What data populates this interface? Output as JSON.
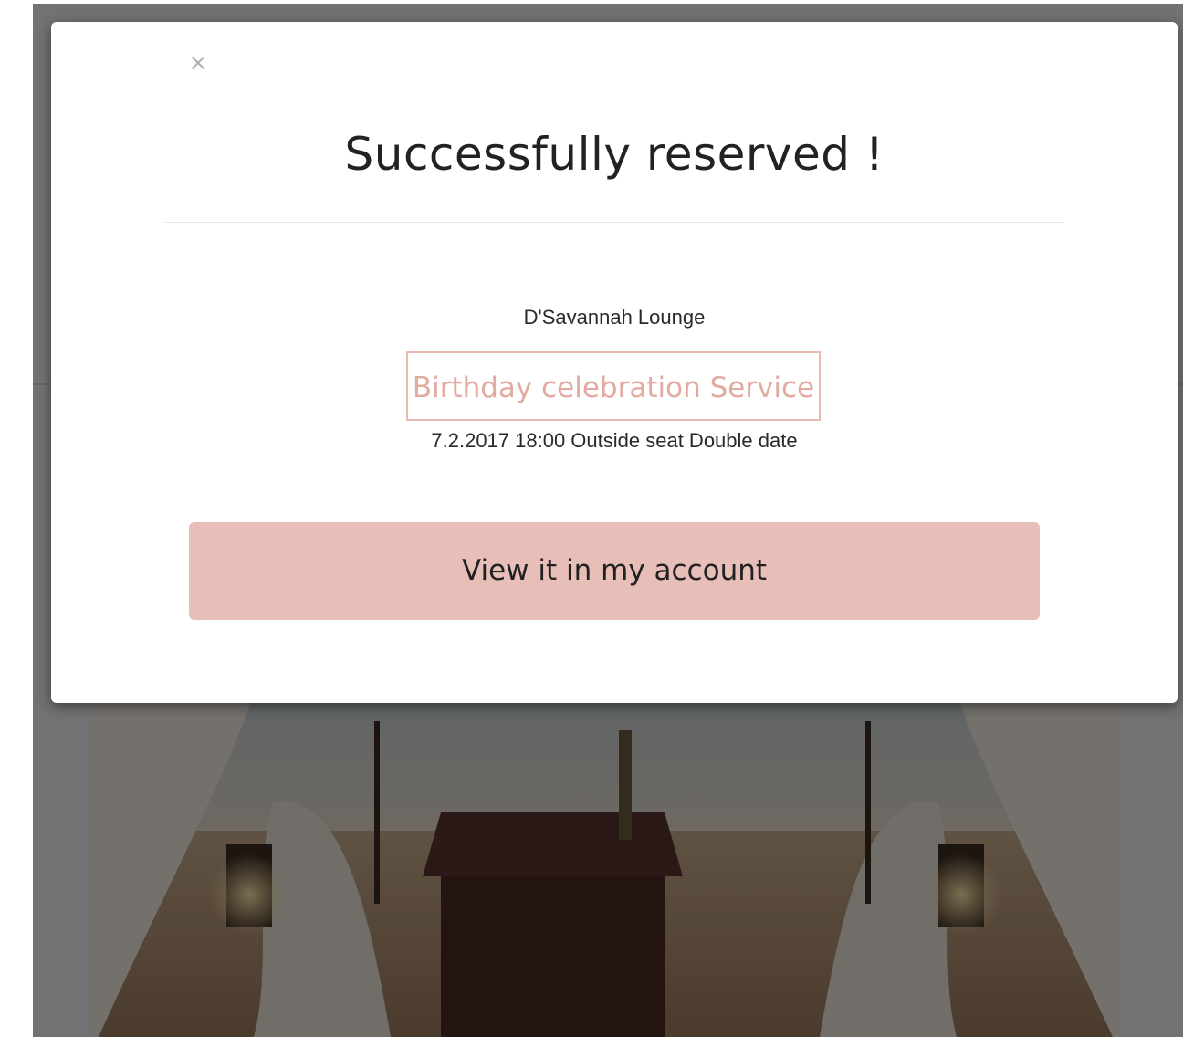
{
  "modal": {
    "close_label": "×",
    "title": "Successfully reserved !",
    "venue_name": "D'Savannah Lounge",
    "service_name": "Birthday celebration Service",
    "reservation_details": "7.2.2017 18:00 Outside seat Double date",
    "view_account_label": "View it in my account"
  },
  "colors": {
    "accent": "#e8beb8",
    "service_text": "#e2aba2",
    "overlay": "rgba(0,0,0,0.52)"
  },
  "icons": {
    "close": "close-icon"
  }
}
